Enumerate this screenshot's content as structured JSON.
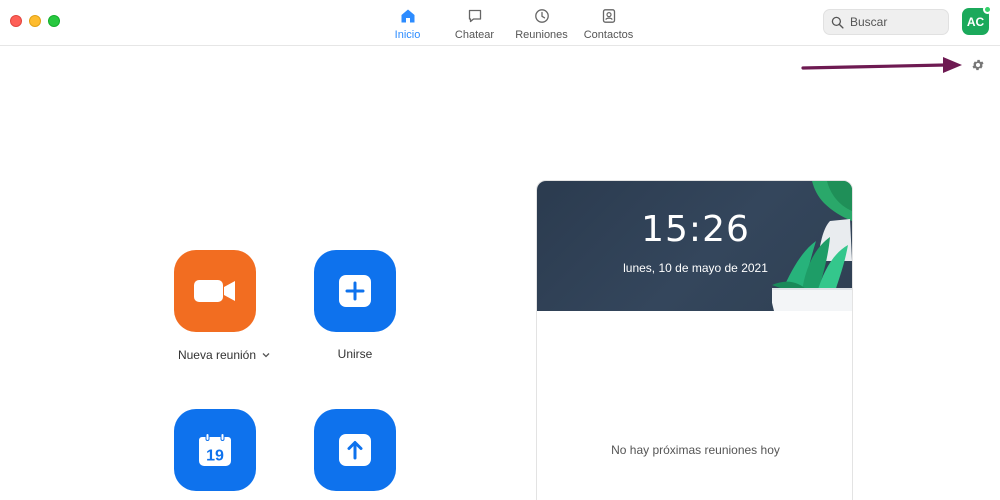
{
  "nav": {
    "tabs": [
      {
        "label": "Inicio",
        "icon": "home-icon",
        "active": true
      },
      {
        "label": "Chatear",
        "icon": "chat-icon",
        "active": false
      },
      {
        "label": "Reuniones",
        "icon": "clock-icon",
        "active": false
      },
      {
        "label": "Contactos",
        "icon": "contacts-icon",
        "active": false
      }
    ]
  },
  "search": {
    "placeholder": "Buscar"
  },
  "user": {
    "initials": "AC",
    "status_color": "#35d36b"
  },
  "actions": {
    "new_meeting": {
      "label": "Nueva reunión",
      "icon": "video-camera-icon",
      "color": "#f26d21"
    },
    "join": {
      "label": "Unirse",
      "icon": "plus-icon",
      "color": "#0e72ed"
    },
    "schedule": {
      "icon": "calendar-icon",
      "day": "19",
      "color": "#0e72ed"
    },
    "share": {
      "icon": "upload-arrow-icon",
      "color": "#0e72ed"
    }
  },
  "calendar": {
    "time": "15:26",
    "date": "lunes, 10 de mayo de 2021",
    "empty_message": "No hay próximas reuniones hoy"
  },
  "colors": {
    "accent": "#2d8cff",
    "annotation_arrow": "#6e1a52"
  }
}
